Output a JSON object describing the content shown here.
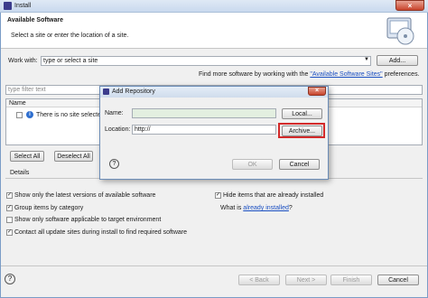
{
  "window": {
    "title": "Install",
    "close_symbol": "×"
  },
  "banner": {
    "title": "Available Software",
    "subtitle": "Select a site or enter the location of a site."
  },
  "work_with": {
    "label": "Work with:",
    "value": "type or select a site",
    "add_label": "Add...",
    "hint_prefix": "Find more software by working with the ",
    "hint_link": "\"Available Software Sites\"",
    "hint_suffix": " preferences."
  },
  "filter": {
    "placeholder": "type filter text"
  },
  "table": {
    "header_name": "Name",
    "row_text": "There is no site selecte"
  },
  "buttons": {
    "select_all": "Select All",
    "deselect_all": "Deselect All"
  },
  "details": {
    "label": "Details"
  },
  "options": {
    "latest_versions": "Show only the latest versions of available software",
    "hide_installed": "Hide items that are already installed",
    "group_by_category": "Group items by category",
    "what_is_prefix": "What is ",
    "already_installed_link": "already installed",
    "what_is_suffix": "?",
    "show_applicable": "Show only software applicable to target environment",
    "contact_all": "Contact all update sites during install to find required software"
  },
  "footer": {
    "back": "< Back",
    "next": "Next >",
    "finish": "Finish",
    "cancel": "Cancel",
    "help_symbol": "?"
  },
  "dialog": {
    "title": "Add Repository",
    "name_label": "Name:",
    "name_value": "",
    "local_label": "Local...",
    "location_label": "Location:",
    "location_value": "http://",
    "archive_label": "Archive...",
    "ok_label": "OK",
    "cancel_label": "Cancel",
    "help_symbol": "?"
  }
}
